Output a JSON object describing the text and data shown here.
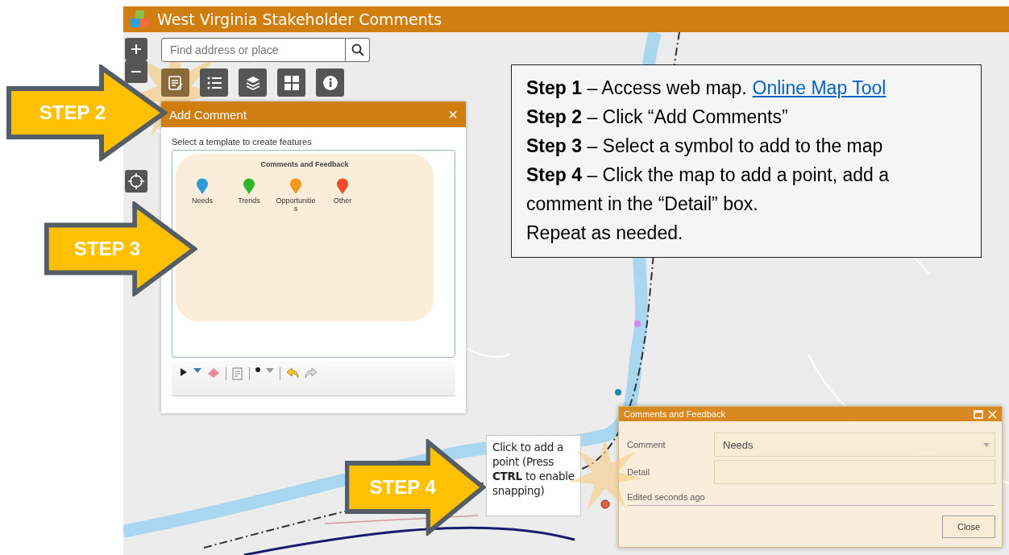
{
  "app_header": {
    "title": "West Virginia Stakeholder Comments"
  },
  "search": {
    "placeholder": "Find address or place"
  },
  "toolbar": [
    {
      "kind": "edit",
      "selected": true
    },
    {
      "kind": "list",
      "selected": false
    },
    {
      "kind": "layers",
      "selected": false
    },
    {
      "kind": "grid",
      "selected": false
    },
    {
      "kind": "info",
      "selected": false
    }
  ],
  "add_comment_panel": {
    "title": "Add Comment",
    "close": "×",
    "instruction": "Select a template to create features",
    "group_title": "Comments and Feedback",
    "templates": [
      {
        "label": "Needs",
        "color": "#2e9bd6"
      },
      {
        "label": "Trends",
        "color": "#2fb52a"
      },
      {
        "label": "Opportunities",
        "color": "#f39a1c"
      },
      {
        "label": "Other",
        "color": "#f04a24"
      }
    ]
  },
  "instructions": [
    {
      "text": "**Step 1** – Access web map.",
      "link": "Online Map Tool"
    },
    {
      "text": "**Step 2** – Click “Add Comments”"
    },
    {
      "text": "**Step 3** – Select a symbol to add to the map"
    },
    {
      "text": "**Step 4** – Click the map to add a point, add a comment in the “Detail” box."
    },
    {
      "text": "Repeat as needed."
    }
  ],
  "tooltip": "Click to add a point (Press **CTRL** to enable snapping)",
  "popup": {
    "title": "Comments and Feedback",
    "fields": [
      {
        "kind": "select",
        "label": "Comment",
        "value": "Needs"
      },
      {
        "kind": "text",
        "label": "Detail"
      }
    ],
    "edited": "Edited seconds ago",
    "button": "Close"
  },
  "step_callouts": [
    {
      "label": "STEP 2"
    },
    {
      "label": "STEP 3"
    },
    {
      "label": "STEP 4"
    }
  ]
}
